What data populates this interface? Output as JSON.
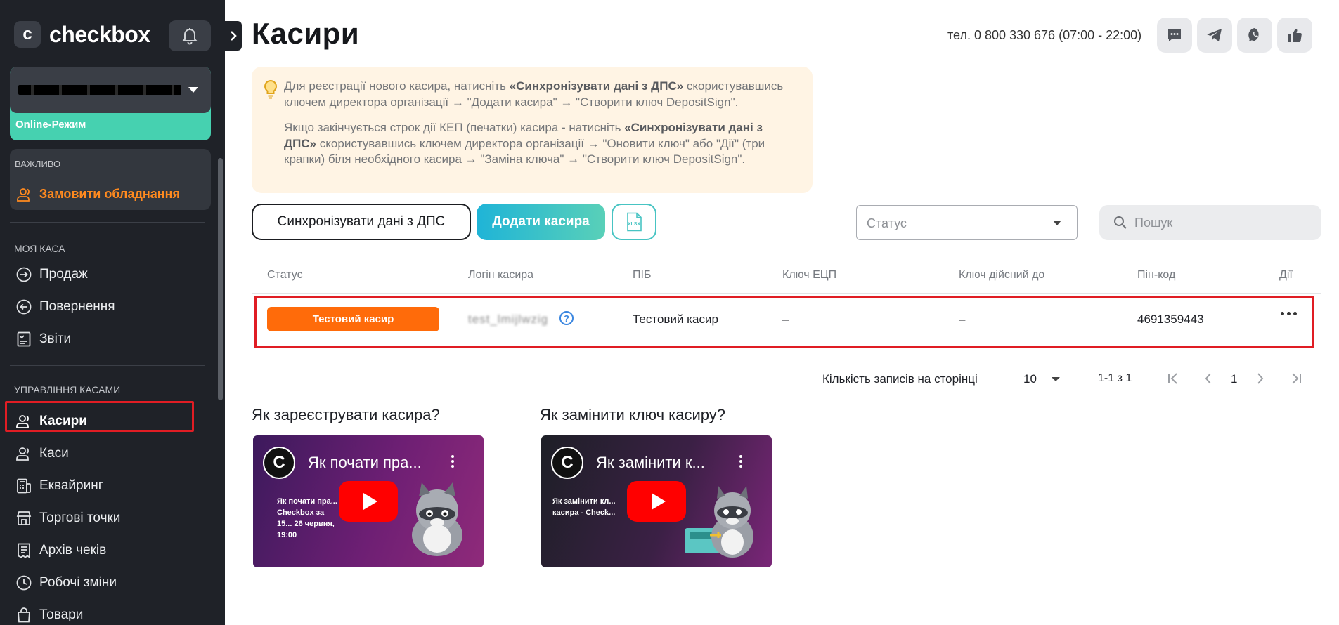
{
  "sidebar": {
    "logo_letter": "c",
    "logo_text": "checkbox",
    "org_mode": "Online-Режим",
    "important": {
      "title": "Важливо",
      "link": "Замовити обладнання"
    },
    "my_cash": {
      "title": "Моя каса",
      "items": [
        {
          "label": "Продаж",
          "icon": "login-arrow-icon"
        },
        {
          "label": "Повернення",
          "icon": "return-arrow-icon"
        },
        {
          "label": "Звіти",
          "icon": "report-icon"
        }
      ]
    },
    "management": {
      "title": "Управління касами",
      "items": [
        {
          "label": "Касири",
          "icon": "users-icon",
          "active": true
        },
        {
          "label": "Каси",
          "icon": "users-icon"
        },
        {
          "label": "Еквайринг",
          "icon": "terminal-icon"
        },
        {
          "label": "Торгові точки",
          "icon": "store-icon"
        },
        {
          "label": "Архів чеків",
          "icon": "receipt-icon"
        },
        {
          "label": "Робочі зміни",
          "icon": "clock-icon"
        },
        {
          "label": "Товари",
          "icon": "bag-icon"
        }
      ]
    }
  },
  "header": {
    "title": "Касири",
    "phone": "тел. 0 800 330 676 (07:00 - 22:00)",
    "buttons": [
      "chat-icon",
      "telegram-icon",
      "viber-icon",
      "thumbs-up-icon"
    ]
  },
  "info": {
    "p1_a": "Для реєстрації нового касира, натисніть ",
    "p1_b": "«Синхронізувати дані з ДПС»",
    "p1_c": " скористувавшись ключем директора організації → \"Додати касира\" → \"Створити ключ DepositSign\".",
    "p2_a": "Якщо закінчується строк дії КЕП (печатки) касира - натисніть ",
    "p2_b": "«Синхронізувати дані з ДПС»",
    "p2_c": " скористувавшись ключем директора організації → \"Оновити ключ\" або \"Дії\" (три крапки) біля необхідного касира → \"Заміна ключа\" → \"Створити ключ DepositSign\"."
  },
  "toolbar": {
    "sync_label": "Синхронізувати дані з ДПС",
    "add_label": "Додати касира",
    "xlsx_label": "XLSX",
    "status_placeholder": "Статус",
    "search_placeholder": "Пошук"
  },
  "table": {
    "columns": [
      "Статус",
      "Логін касира",
      "ПІБ",
      "Ключ ЕЦП",
      "Ключ дійсний до",
      "Пін-код",
      "Дії"
    ],
    "rows": [
      {
        "status": "Тестовий касир",
        "login": "test_lmijlwzig",
        "name": "Тестовий касир",
        "key": "–",
        "valid_until": "–",
        "pin": "4691359443"
      }
    ]
  },
  "pagination": {
    "per_page_label": "Кількість записів на сторінці",
    "per_page": "10",
    "range": "1-1 з 1",
    "page": "1"
  },
  "videos": [
    {
      "heading": "Як зареєструвати касира?",
      "title": "Як почати пра...",
      "overlay": "Як почати пра... Checkbox за 15... 26 червня, 19:00"
    },
    {
      "heading": "Як замінити ключ касиру?",
      "title": "Як замінити к...",
      "overlay": "Як замінити кл... касира - Check..."
    }
  ],
  "colors": {
    "accent_orange": "#ff6b0a",
    "accent_teal": "#46d1b0",
    "highlight_red": "#e01d24",
    "sidebar_bg": "#1f2228"
  }
}
